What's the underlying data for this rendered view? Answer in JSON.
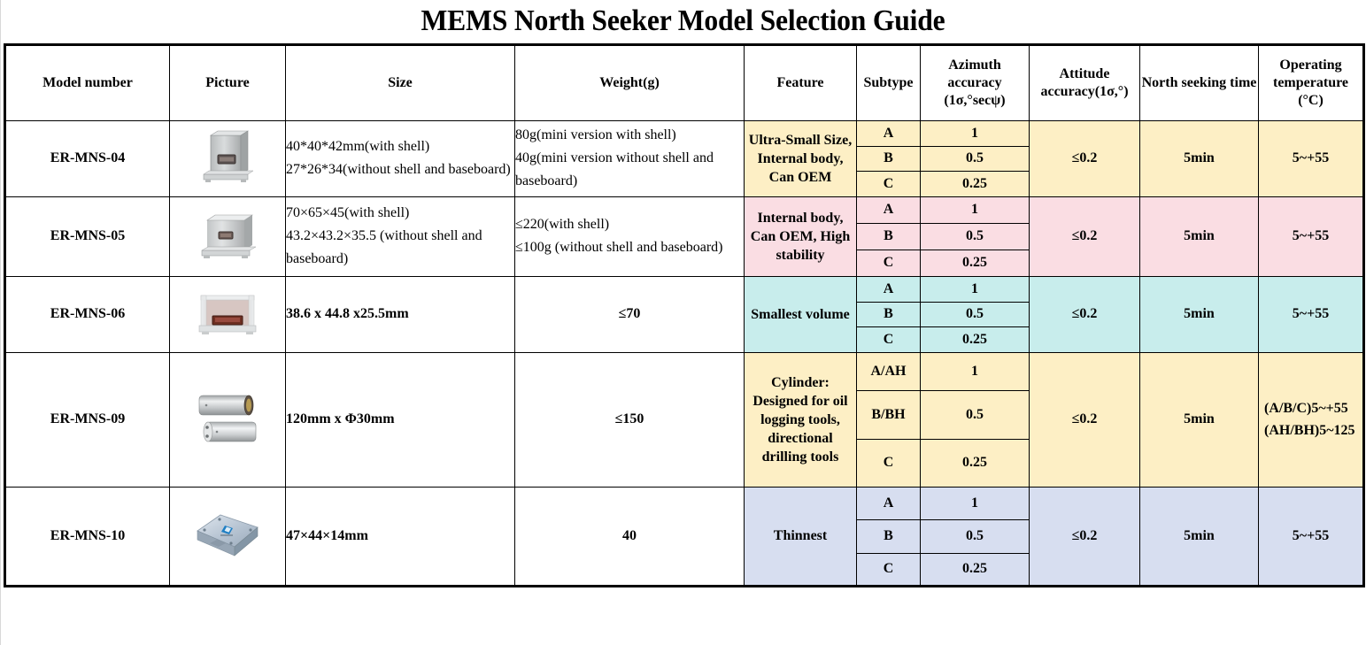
{
  "title": "MEMS North Seeker Model Selection Guide",
  "table": {
    "headers": {
      "model_number": "Model number",
      "picture": "Picture",
      "size": "Size",
      "weight": "Weight(g)",
      "feature": "Feature",
      "subtype": "Subtype",
      "azimuth_accuracy_l1": "Azimuth",
      "azimuth_accuracy_l2": "accuracy",
      "azimuth_accuracy_l3": "(1σ,°secψ)",
      "attitude_accuracy": "Attitude accuracy(1σ,°)",
      "north_seeking_time": "North seeking time",
      "operating_temperature_l1": "Operating",
      "operating_temperature_l2": "temperature",
      "operating_temperature_l3": "(°C)"
    },
    "colors": {
      "row1_bg": "#FDEFC5",
      "row2_bg": "#FADDE3",
      "row3_bg": "#C8EDEC",
      "row4_bg": "#FDEFC5",
      "row5_bg": "#D7DEF0",
      "border": "#000000",
      "header_bg": "#FFFFFF"
    },
    "rows": [
      {
        "model": "ER-MNS-04",
        "picture_icon": "mems-box-sensor-image",
        "size_lines": [
          "40*40*42mm(with shell)",
          "27*26*34(without shell and baseboard)"
        ],
        "size_bold": false,
        "size_center": false,
        "weight_lines": [
          "80g(mini version with shell)",
          "40g(mini version without shell and baseboard)"
        ],
        "weight_bold": false,
        "weight_center": false,
        "feature": "Ultra-Small Size, Internal body, Can OEM",
        "subtypes": [
          "A",
          "B",
          "C"
        ],
        "azimuth": [
          "1",
          "0.5",
          "0.25"
        ],
        "attitude": "≤0.2",
        "north_time": "5min",
        "operating_temp": "5~+55",
        "operating_temp_left": false,
        "bg": "#FDEFC5"
      },
      {
        "model": "ER-MNS-05",
        "picture_icon": "mems-cube-sensor-image",
        "size_lines": [
          "70×65×45(with shell)",
          "43.2×43.2×35.5 (without shell and baseboard)"
        ],
        "size_bold": false,
        "size_center": false,
        "weight_lines": [
          "≤220(with shell)",
          "≤100g (without shell and baseboard)"
        ],
        "weight_bold": false,
        "weight_center": false,
        "feature": "Internal body, Can OEM, High stability",
        "subtypes": [
          "A",
          "B",
          "C"
        ],
        "azimuth": [
          "1",
          "0.5",
          "0.25"
        ],
        "attitude": "≤0.2",
        "north_time": "5min",
        "operating_temp": "5~+55",
        "operating_temp_left": false,
        "bg": "#FADDE3"
      },
      {
        "model": "ER-MNS-06",
        "picture_icon": "mems-open-frame-sensor-image",
        "size_lines": [
          "38.6 x 44.8 x25.5mm"
        ],
        "size_bold": true,
        "size_center": false,
        "weight_lines": [
          "≤70"
        ],
        "weight_bold": true,
        "weight_center": true,
        "feature": "Smallest volume",
        "subtypes": [
          "A",
          "B",
          "C"
        ],
        "azimuth": [
          "1",
          "0.5",
          "0.25"
        ],
        "attitude": "≤0.2",
        "north_time": "5min",
        "operating_temp": "5~+55",
        "operating_temp_left": false,
        "bg": "#C8EDEC"
      },
      {
        "model": "ER-MNS-09",
        "picture_icon": "mems-cylinder-sensor-image",
        "size_lines": [
          "120mm x Φ30mm"
        ],
        "size_bold": true,
        "size_center": false,
        "weight_lines": [
          "≤150"
        ],
        "weight_bold": true,
        "weight_center": true,
        "feature": "Cylinder: Designed for oil logging tools, directional drilling tools",
        "subtypes": [
          "A/AH",
          "B/BH",
          "C"
        ],
        "azimuth": [
          "1",
          "0.5",
          "0.25"
        ],
        "attitude": "≤0.2",
        "north_time": "5min",
        "operating_temp": "(A/B/C)5~+55 (AH/BH)5~125",
        "operating_temp_left": true,
        "bg": "#FDEFC5"
      },
      {
        "model": "ER-MNS-10",
        "picture_icon": "mems-flat-plate-sensor-image",
        "size_lines": [
          "47×44×14mm"
        ],
        "size_bold": true,
        "size_center": false,
        "weight_lines": [
          "40"
        ],
        "weight_bold": true,
        "weight_center": true,
        "feature": "Thinnest",
        "subtypes": [
          "A",
          "B",
          "C"
        ],
        "azimuth": [
          "1",
          "0.5",
          "0.25"
        ],
        "attitude": "≤0.2",
        "north_time": "5min",
        "operating_temp": "5~+55",
        "operating_temp_left": false,
        "bg": "#D7DEF0"
      }
    ]
  }
}
